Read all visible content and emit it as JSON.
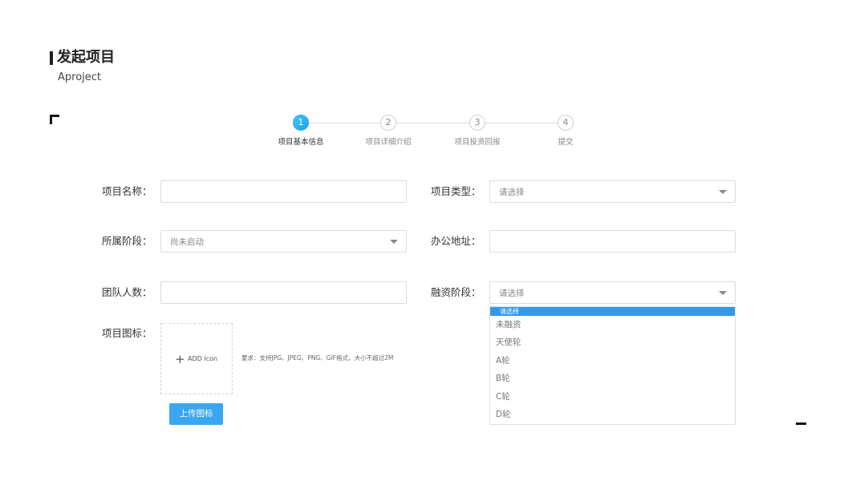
{
  "header": {
    "title": "发起项目",
    "subtitle": "Aproject"
  },
  "stepper": {
    "active_step": 1,
    "steps": [
      {
        "number": "1",
        "label": "项目基本信息"
      },
      {
        "number": "2",
        "label": "项目详细介绍"
      },
      {
        "number": "3",
        "label": "项目投资回报"
      },
      {
        "number": "4",
        "label": "提交"
      }
    ],
    "accent_color": "#2aa7f2"
  },
  "form": {
    "project_name": {
      "label": "项目名称：",
      "value": ""
    },
    "project_type": {
      "label": "项目类型：",
      "value": "请选择"
    },
    "stage": {
      "label": "所属阶段：",
      "value": "尚未启动"
    },
    "office_address": {
      "label": "办公地址：",
      "value": ""
    },
    "team_size": {
      "label": "团队人数：",
      "value": ""
    },
    "funding_stage": {
      "label": "融资阶段：",
      "value": "请选择",
      "dropdown_open": true,
      "highlighted_option": "请选择",
      "options": [
        "未融资",
        "天使轮",
        "A轮",
        "B轮",
        "C轮",
        "D轮"
      ]
    },
    "project_icon": {
      "label": "项目图标：",
      "add_text": "ADD  Icon",
      "hint": "要求：支持JPG、JPEG、PNG、GIF格式，大小不超过2M",
      "upload_button": "上传图标"
    }
  },
  "colors": {
    "primary": "#39a6f2",
    "dropdown_highlight": "#3399ea"
  }
}
